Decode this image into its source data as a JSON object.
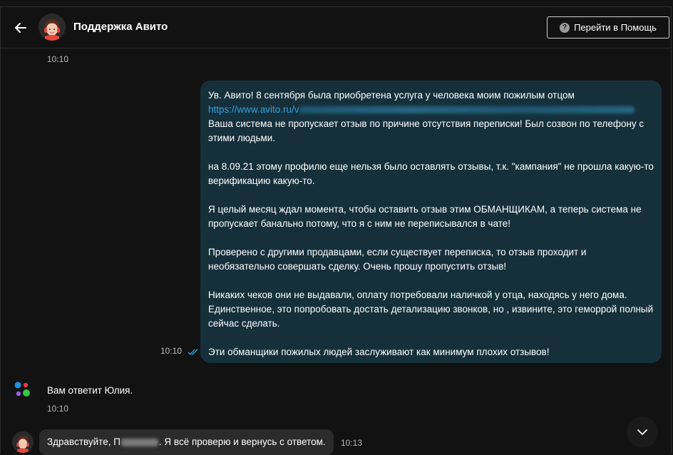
{
  "header": {
    "title": "Поддержка Авито",
    "help_button_label": "Перейти в Помощь"
  },
  "messages": {
    "top_time": "10:10",
    "outgoing": {
      "line1": "Ув. Авито! 8 сентября была приобретена услуга у человека моим пожилым отцом",
      "link": "https://www.avito.ru/v",
      "line2": "Ваша система не пропускает отзыв по причине отсутствия переписки! Был созвон по телефону с этими людьми.",
      "para2": "на 8.09.21 этому профилю еще нельзя было оставлять отзывы, т.к. \"кампания\" не прошла какую-то верификацию какую-то.",
      "para3": "Я целый месяц ждал момента, чтобы оставить отзыв этим ОБМАНЩИКАМ, а теперь система не пропускает банально потому, что я с ним не переписывался в чате!",
      "para4": "Проверено с другими продавцами, если существует переписка, то отзыв проходит и необязательно совершать сделку. Очень прошу пропустить отзыв!",
      "para5": "Никаких чеков они не выдавали, оплату потребовали наличкой у отца, находясь у него дома. Единственное, это попробовать достать детализацию звонков, но , извините, это геморрой полный сейчас сделать.",
      "para6": "Эти обманщики пожилых людей заслуживают как минимум плохих отзывов!",
      "time": "10:10"
    },
    "system": {
      "text": "Вам ответит Юлия.",
      "time": "10:10"
    },
    "incoming": {
      "text_before": "Здравствуйте, П",
      "text_after": ". Я всё проверю и вернусь с ответом.",
      "time": "10:13"
    }
  },
  "colors": {
    "background": "#121212",
    "outgoing_bubble": "#15303b",
    "incoming_bubble": "#2b2b2b",
    "link": "#2fa2e2",
    "read_ticks": "#2fa2e2"
  },
  "icons": {
    "back": "arrow-left-icon",
    "help": "question-circle-icon",
    "scroll": "chevron-down-icon",
    "read": "double-check-icon",
    "system": "avito-dots-icon"
  }
}
